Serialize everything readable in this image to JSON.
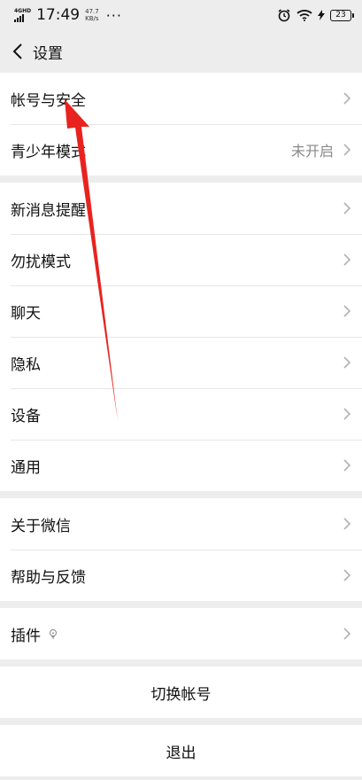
{
  "status_bar": {
    "network": "4GHD",
    "time": "17:49",
    "speed_value": "47.7",
    "speed_unit": "KB/s",
    "more": "···",
    "battery": "23"
  },
  "nav": {
    "title": "设置"
  },
  "groups": [
    {
      "items": [
        {
          "label": "帐号与安全"
        },
        {
          "label": "青少年模式",
          "value": "未开启"
        }
      ]
    },
    {
      "items": [
        {
          "label": "新消息提醒"
        },
        {
          "label": "勿扰模式"
        },
        {
          "label": "聊天"
        },
        {
          "label": "隐私"
        },
        {
          "label": "设备"
        },
        {
          "label": "通用"
        }
      ]
    },
    {
      "items": [
        {
          "label": "关于微信"
        },
        {
          "label": "帮助与反馈"
        }
      ]
    },
    {
      "items": [
        {
          "label": "插件"
        }
      ]
    }
  ],
  "buttons": {
    "switch_account": "切换帐号",
    "logout": "退出"
  },
  "colors": {
    "background": "#ededed",
    "annotation_arrow": "#e8231f"
  }
}
